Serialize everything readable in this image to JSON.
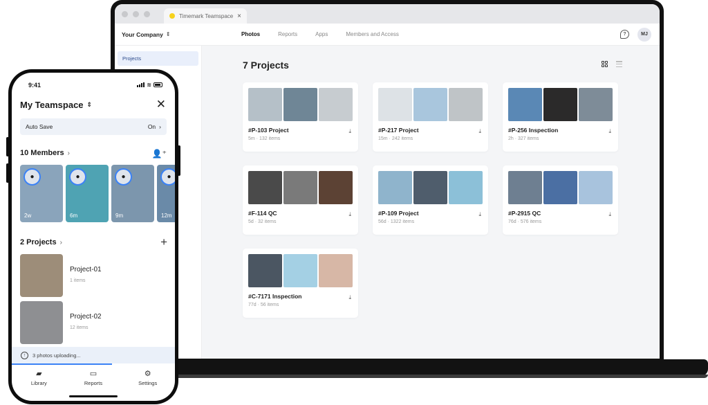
{
  "colors": {
    "accent": "#3b82f6",
    "sidebar_active_bg": "#e9effb",
    "tab_dot": "#f7d21c"
  },
  "browser": {
    "tab_title": "Timemark Teamspace",
    "tab_close_icon": "close-icon"
  },
  "web": {
    "company": "Your Company",
    "nav": [
      "Photos",
      "Reports",
      "Apps",
      "Members and Access"
    ],
    "avatar_initials": "MJ",
    "sidebar": {
      "projects_label": "Projects"
    },
    "projects_heading": "7 Projects",
    "projects": [
      {
        "name": "#P-103 Project",
        "meta": "5m · 132 items",
        "thumbs": [
          "#b5c0c8",
          "#6f8696",
          "#c7ccd0"
        ]
      },
      {
        "name": "#P-217 Project",
        "meta": "15m · 242 items",
        "thumbs": [
          "#dde2e6",
          "#a9c6dd",
          "#bfc4c7"
        ]
      },
      {
        "name": "#P-256 Inspection",
        "meta": "2h · 327 items",
        "thumbs": [
          "#5a88b5",
          "#2b2a2a",
          "#7e8c98"
        ]
      },
      {
        "name": "#F-114 QC",
        "meta": "5d · 32 items",
        "thumbs": [
          "#4a4a4a",
          "#7a7a7a",
          "#5c4234"
        ]
      },
      {
        "name": "#P-109 Project",
        "meta": "56d · 1322 items",
        "thumbs": [
          "#8fb4cc",
          "#4f5d6c",
          "#8cc0d8"
        ]
      },
      {
        "name": "#P-2915 QC",
        "meta": "76d · 576 items",
        "thumbs": [
          "#6e7f91",
          "#4b6fa3",
          "#a8c3dd"
        ]
      },
      {
        "name": "#C-7171 Inspection",
        "meta": "77d · 56 items",
        "thumbs": [
          "#4b5662",
          "#a4d0e4",
          "#d7b7a6"
        ]
      }
    ]
  },
  "phone": {
    "time": "9:41",
    "teamspace": "My Teamspace",
    "autosave_label": "Auto Save",
    "autosave_value": "On",
    "members_heading": "10 Members",
    "members": [
      {
        "age": "2w",
        "color": "#8aa4bb"
      },
      {
        "age": "6m",
        "color": "#4fa3b3"
      },
      {
        "age": "9m",
        "color": "#7c96ad"
      },
      {
        "age": "12m",
        "color": "#6a8aa8"
      }
    ],
    "projects_heading": "2 Projects",
    "projects": [
      {
        "name": "Project-01",
        "count": "1 items",
        "color": "#9d8d79"
      },
      {
        "name": "Project-02",
        "count": "12 items",
        "color": "#8e8f92"
      }
    ],
    "uploading": "3 photos uploading...",
    "tabs": [
      "Library",
      "Reports",
      "Settings"
    ]
  }
}
